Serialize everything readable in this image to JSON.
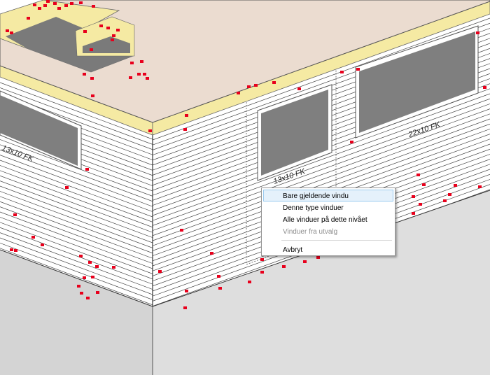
{
  "scene": {
    "window_labels": [
      "13x10 FK",
      "22x10 FK",
      "13x10 FK"
    ],
    "colors": {
      "roof_surface": "#ebdcd0",
      "insulation": "#f5eaa3",
      "siding_wall": "#ffffff",
      "siding_lines": "#444444",
      "foundation": "#d9d9d9",
      "glass": "#7f7f7f",
      "marker": "#e8001c"
    }
  },
  "context_menu": {
    "items": [
      {
        "label": "Bare gjeldende vindu",
        "highlighted": true,
        "enabled": true
      },
      {
        "label": "Denne type vinduer",
        "highlighted": false,
        "enabled": true
      },
      {
        "label": "Alle vinduer på dette nivået",
        "highlighted": false,
        "enabled": true
      },
      {
        "label": "Vinduer fra utvalg",
        "highlighted": false,
        "enabled": false
      }
    ],
    "cancel_label": "Avbryt"
  }
}
